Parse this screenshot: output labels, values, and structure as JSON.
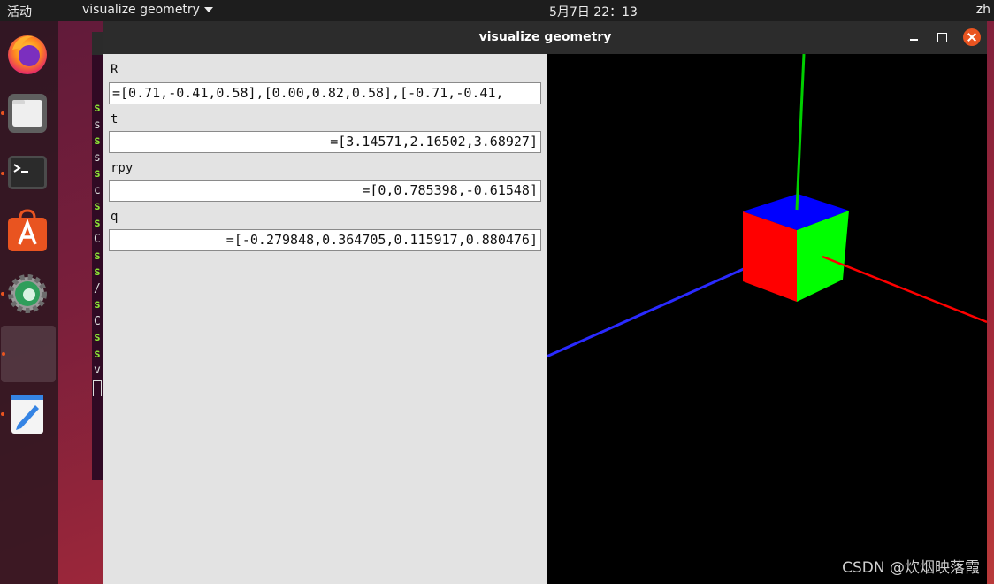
{
  "topbar": {
    "activities": "活动",
    "app_menu": "visualize geometry",
    "clock": "5月7日  22：13",
    "lang": "zh"
  },
  "dock": [
    {
      "name": "firefox-icon",
      "running": false
    },
    {
      "name": "files-icon",
      "running": true
    },
    {
      "name": "terminal-icon",
      "running": true
    },
    {
      "name": "software-store-icon",
      "running": false
    },
    {
      "name": "settings-icon",
      "running": true
    },
    {
      "name": "running-app-icon",
      "running": true
    },
    {
      "name": "text-editor-icon",
      "running": true
    }
  ],
  "terminal": {
    "lines": [
      "s",
      "s",
      "s",
      "s",
      "s",
      "c",
      "s",
      "s",
      "C",
      "s",
      "s",
      "/",
      "s",
      "C",
      "s",
      "s",
      "v"
    ]
  },
  "window": {
    "title": "visualize geometry"
  },
  "fields": [
    {
      "label": "R",
      "value": "=[0.71,-0.41,0.58],[0.00,0.82,0.58],[-0.71,-0.41,"
    },
    {
      "label": "t",
      "value": "=[3.14571,2.16502,3.68927]"
    },
    {
      "label": "rpy",
      "value": "=[0,0.785398,-0.61548]"
    },
    {
      "label": "q",
      "value": "=[-0.279848,0.364705,0.115917,0.880476]"
    }
  ],
  "scene": {
    "axis_colors": {
      "x": "#ff0000",
      "y": "#00d000",
      "z": "#2a2aff"
    },
    "cube_faces": {
      "top": "#0000ff",
      "left": "#ff0000",
      "right": "#00ff00"
    }
  },
  "watermark": "CSDN @炊烟映落霞"
}
